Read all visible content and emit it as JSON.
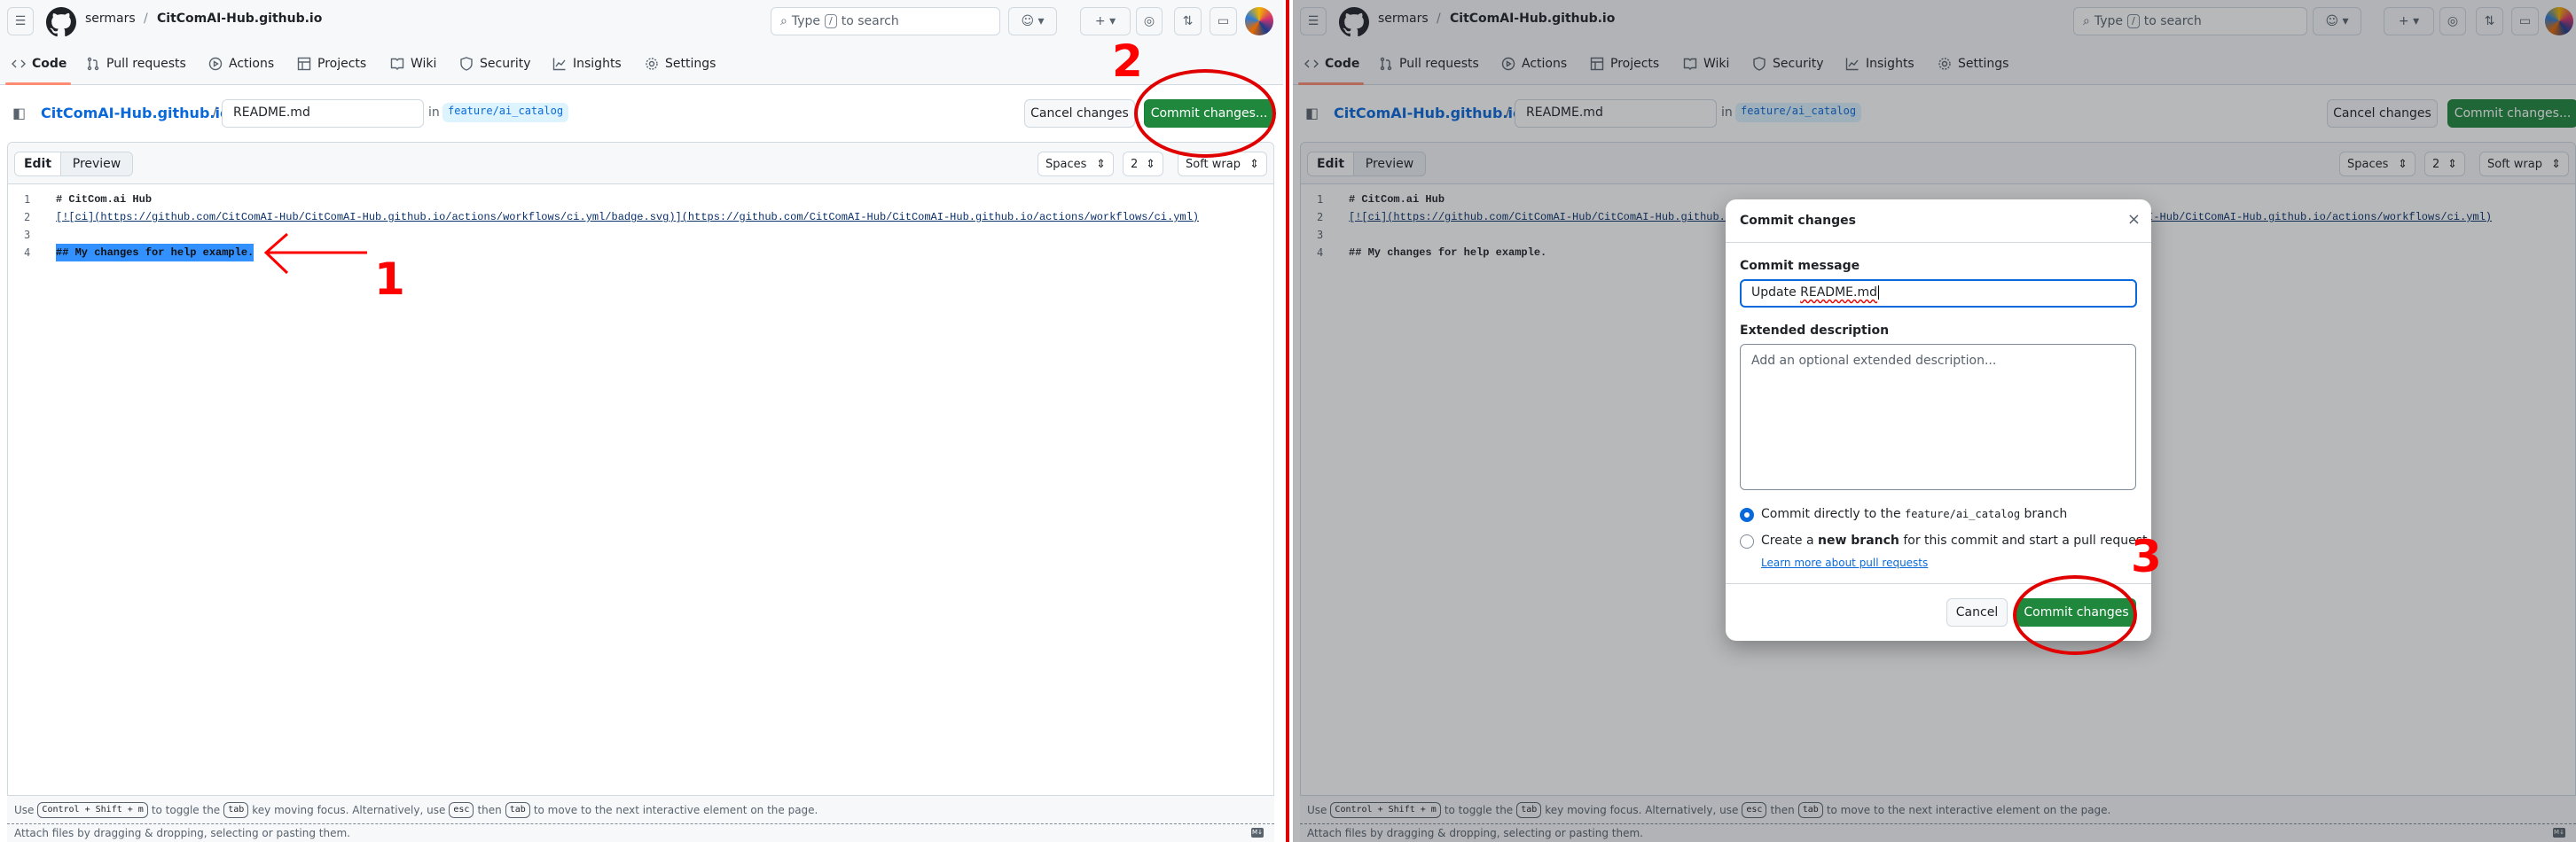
{
  "header": {
    "owner": "sermars",
    "separator": "/",
    "repo": "CitComAI-Hub.github.io",
    "search": {
      "prefix": "Type",
      "key": "/",
      "suffix": "to search"
    }
  },
  "nav": {
    "tabs": [
      {
        "label": "Code",
        "icon": "code-icon"
      },
      {
        "label": "Pull requests",
        "icon": "git-pull-request-icon"
      },
      {
        "label": "Actions",
        "icon": "play-icon"
      },
      {
        "label": "Projects",
        "icon": "table-icon"
      },
      {
        "label": "Wiki",
        "icon": "book-icon"
      },
      {
        "label": "Security",
        "icon": "shield-icon"
      },
      {
        "label": "Insights",
        "icon": "graph-icon"
      },
      {
        "label": "Settings",
        "icon": "gear-icon"
      }
    ],
    "active": "Code"
  },
  "path": {
    "repo": "CitComAI-Hub.github.io",
    "separator": "/",
    "filename": "README.md",
    "in_label": "in",
    "branch": "feature/ai_catalog",
    "cancel_label": "Cancel changes",
    "commit_label": "Commit changes..."
  },
  "editor": {
    "edit_tab": "Edit",
    "preview_tab": "Preview",
    "indent_mode": "Spaces",
    "indent_size": "2",
    "wrap_mode": "Soft wrap",
    "lines": [
      {
        "num": "1",
        "text": "# CitCom.ai Hub"
      },
      {
        "num": "2",
        "text": "[![ci](https://github.com/CitComAI-Hub/CitComAI-Hub.github.io/actions/workflows/ci.yml/badge.svg)](https://github.com/CitComAI-Hub/CitComAI-Hub.github.io/actions/workflows/ci.yml)"
      },
      {
        "num": "3",
        "text": ""
      },
      {
        "num": "4",
        "text": "## My changes for help example."
      }
    ]
  },
  "footer": {
    "use": "Use",
    "shortcut": "Control + Shift + m",
    "toggle": "to toggle the",
    "tab_key": "tab",
    "moving": "key moving focus. Alternatively, use",
    "esc_key": "esc",
    "then": "then",
    "tail": "to move to the next interactive element on the page.",
    "attach": "Attach files by dragging & dropping, selecting or pasting them.",
    "markdown_badge": "M↓"
  },
  "modal": {
    "title": "Commit changes",
    "close": "×",
    "message_label": "Commit message",
    "message_prefix": "Update ",
    "message_value_flagged": "README.md",
    "description_label": "Extended description",
    "description_placeholder": "Add an optional extended description...",
    "option_direct": {
      "before": "Commit directly to the",
      "branch": "feature/ai_catalog",
      "after": "branch",
      "selected": true
    },
    "option_new": {
      "before": "Create a",
      "bold": "new branch",
      "after": "for this commit and start a pull request",
      "selected": false
    },
    "learn_more": "Learn more about pull requests",
    "cancel_label": "Cancel",
    "commit_label": "Commit changes"
  },
  "annotations": {
    "step1": "1",
    "step2": "2",
    "step3": "3",
    "color": "#ff0000"
  },
  "colors": {
    "primary_button": "#1f883d",
    "link": "#0969da",
    "selection": "#3390ff"
  }
}
